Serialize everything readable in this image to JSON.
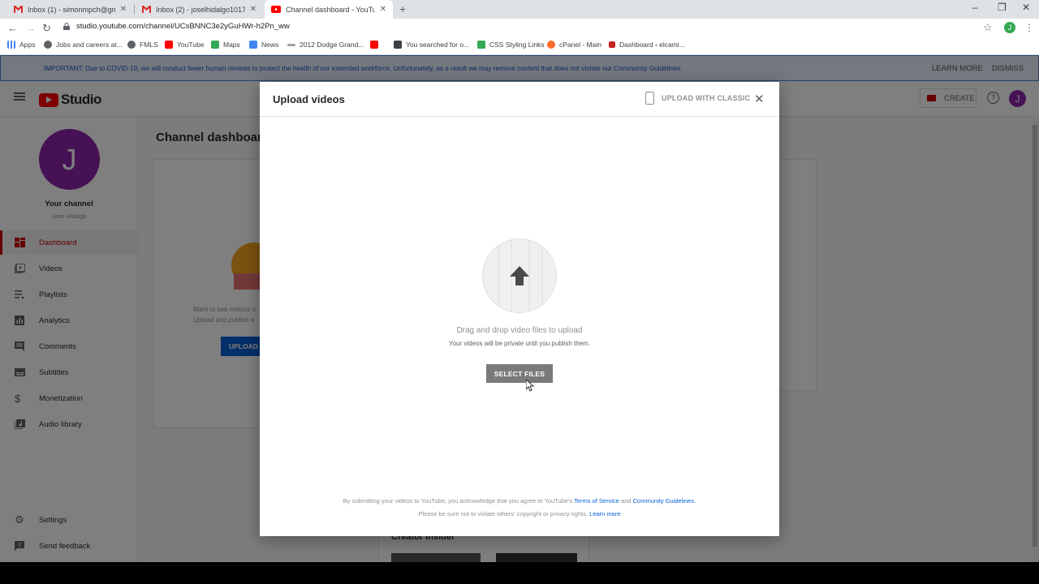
{
  "browser": {
    "tabs": [
      {
        "title": "Inbox (1) - simonmpch@gmail.co",
        "favicon": "gmail-icon"
      },
      {
        "title": "Inbox (2) - joselhidalgo1017@gm",
        "favicon": "gmail-icon"
      },
      {
        "title": "Channel dashboard - YouTube St",
        "favicon": "youtube-icon"
      }
    ],
    "new_tab": "+",
    "url": "studio.youtube.com/channel/UCsBNNC3e2yGuHWr-h2Pn_ww",
    "profile_initial": "J",
    "bookmarks": [
      "Apps",
      "Jobs and careers at...",
      "FMLS",
      "YouTube",
      "Maps",
      "News",
      "2012 Dodge Grand...",
      "",
      "You searched for o...",
      "CSS Styling Links",
      "cPanel - Main",
      "Dashboard ‹ elcami..."
    ]
  },
  "banner": {
    "message": "IMPORTANT: Due to COVID-19, we will conduct fewer human reviews to protect the health of our extended workforce. Unfortunately, as a result we may remove content that does not violate our Community Guidelines",
    "learn_more": "LEARN MORE",
    "dismiss": "DISMISS"
  },
  "header": {
    "logo_text": "Studio",
    "create_label": "CREATE",
    "help": "?",
    "avatar_initial": "J"
  },
  "sidebar": {
    "avatar_initial": "J",
    "channel_title": "Your channel",
    "channel_name": "Jose Hidalgo",
    "items": [
      {
        "label": "Dashboard",
        "icon": "dashboard-icon",
        "active": true
      },
      {
        "label": "Videos",
        "icon": "videos-icon"
      },
      {
        "label": "Playlists",
        "icon": "playlists-icon"
      },
      {
        "label": "Analytics",
        "icon": "analytics-icon"
      },
      {
        "label": "Comments",
        "icon": "comments-icon"
      },
      {
        "label": "Subtitles",
        "icon": "subtitles-icon"
      },
      {
        "label": "Monetization",
        "icon": "dollar-icon"
      },
      {
        "label": "Audio library",
        "icon": "audio-library-icon"
      }
    ],
    "settings": "Settings",
    "feedback": "Send feedback"
  },
  "main": {
    "title": "Channel dashboard",
    "card_text_1": "Want to see metrics o",
    "card_text_2": "Upload and publish a",
    "upload_label": "UPLOAD",
    "creator_insider": "Creator Insider"
  },
  "dialog": {
    "title": "Upload videos",
    "upload_classic": "UPLOAD WITH CLASSIC",
    "drag_text": "Drag and drop video files to upload",
    "private_text": "Your videos will be private until you publish them.",
    "select_files": "SELECT FILES",
    "legal_prefix": "By submitting your videos to YouTube, you acknowledge that you agree to YouTube's",
    "terms": "Terms of Service",
    "and": "and",
    "guidelines": "Community Guidelines",
    "legal_line2": "Please be sure not to violate others' copyright or privacy rights.",
    "learn_more": "Learn more"
  },
  "colors": {
    "accent_red": "#cc0000",
    "link_blue": "#065fd4",
    "avatar_purple": "#8e24aa"
  }
}
